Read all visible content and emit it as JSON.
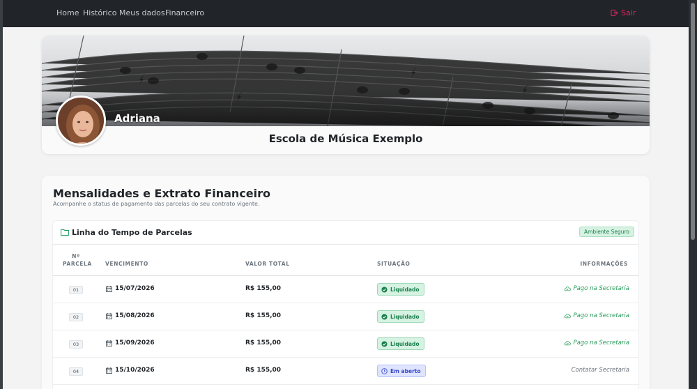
{
  "nav": {
    "items": [
      {
        "label": "Home"
      },
      {
        "label": "Histórico"
      },
      {
        "label": "Meus dados"
      },
      {
        "label": "Financeiro"
      }
    ],
    "logout_label": "Sair",
    "logout_icon": "logout-icon"
  },
  "profile": {
    "name": "Adriana",
    "school": "Escola de Música Exemplo",
    "banner": "sheet-music-banner"
  },
  "finance": {
    "title": "Mensalidades e Extrato Financeiro",
    "subtitle": "Acompanhe o status de pagamento das parcelas do seu contrato vigente.",
    "timeline_title": "Linha do Tempo de Parcelas",
    "secure_badge": "Ambiente Seguro",
    "columns": {
      "parcela_top": "Nº",
      "parcela": "PARCELA",
      "vencimento": "VENCIMENTO",
      "valor": "VALOR TOTAL",
      "situacao": "SITUAÇÃO",
      "info": "INFORMAÇÕES"
    },
    "rows": [
      {
        "num": "01",
        "date": "15/07/2026",
        "amount": "R$ 155,00",
        "status": "Liquidado",
        "status_type": "paid",
        "info": "Pago na Secretaria"
      },
      {
        "num": "02",
        "date": "15/08/2026",
        "amount": "R$ 155,00",
        "status": "Liquidado",
        "status_type": "paid",
        "info": "Pago na Secretaria"
      },
      {
        "num": "03",
        "date": "15/09/2026",
        "amount": "R$ 155,00",
        "status": "Liquidado",
        "status_type": "paid",
        "info": "Pago na Secretaria"
      },
      {
        "num": "04",
        "date": "15/10/2026",
        "amount": "R$ 155,00",
        "status": "Em aberto",
        "status_type": "open",
        "info": "Contatar Secretaria"
      }
    ]
  },
  "colors": {
    "navbar": "#212529",
    "logout": "#e0245e",
    "paid": "#1a7f4b",
    "open": "#3b4bc8"
  }
}
